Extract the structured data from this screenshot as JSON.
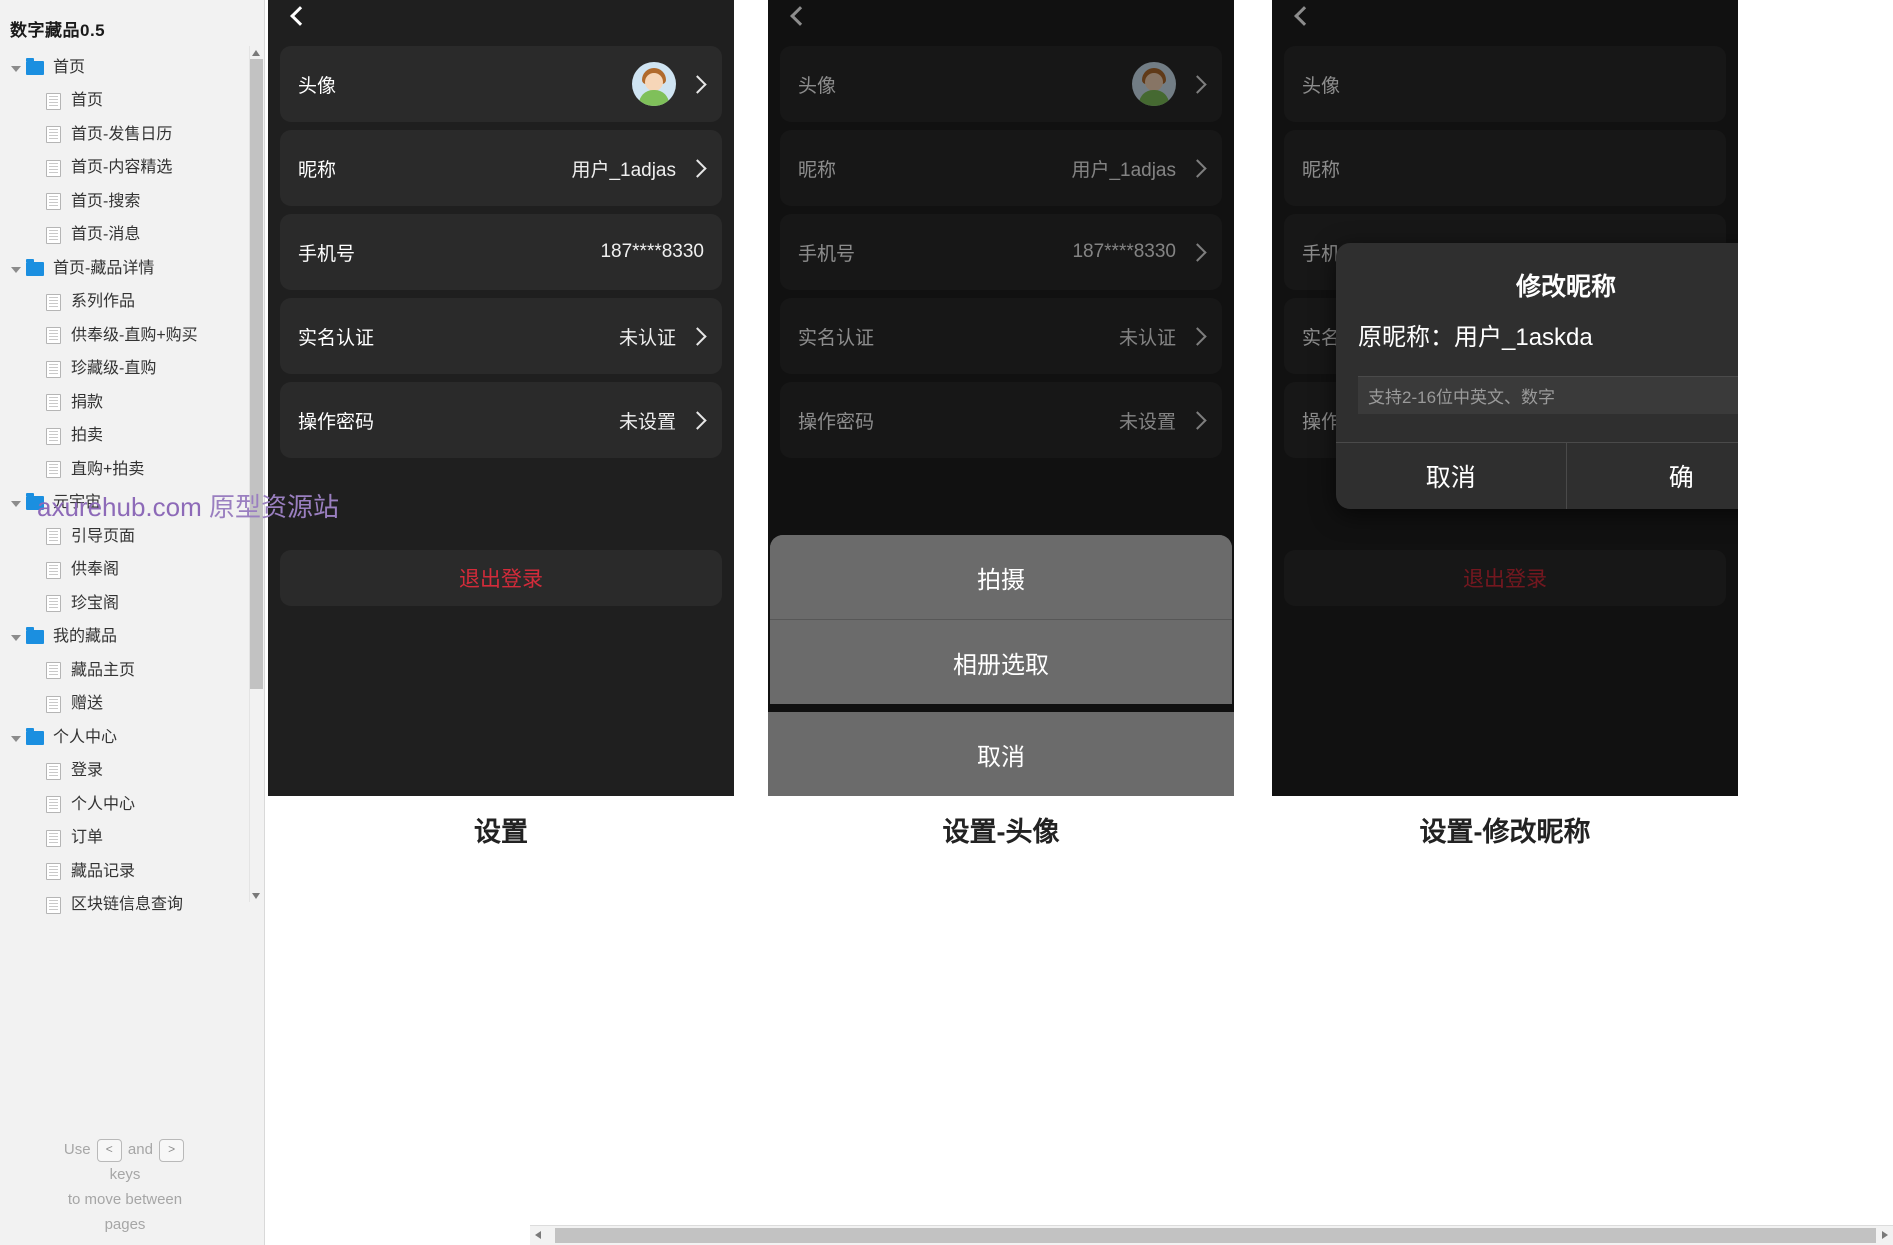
{
  "sidebar": {
    "title": "数字藏品0.5",
    "tree": [
      {
        "type": "folder",
        "label": "首页"
      },
      {
        "type": "page",
        "label": "首页"
      },
      {
        "type": "page",
        "label": "首页-发售日历"
      },
      {
        "type": "page",
        "label": "首页-内容精选"
      },
      {
        "type": "page",
        "label": "首页-搜索"
      },
      {
        "type": "page",
        "label": "首页-消息"
      },
      {
        "type": "folder",
        "label": "首页-藏品详情"
      },
      {
        "type": "page",
        "label": "系列作品"
      },
      {
        "type": "page",
        "label": "供奉级-直购+购买"
      },
      {
        "type": "page",
        "label": "珍藏级-直购"
      },
      {
        "type": "page",
        "label": "捐款"
      },
      {
        "type": "page",
        "label": "拍卖"
      },
      {
        "type": "page",
        "label": "直购+拍卖"
      },
      {
        "type": "folder",
        "label": "元宇宙"
      },
      {
        "type": "page",
        "label": "引导页面"
      },
      {
        "type": "page",
        "label": "供奉阁"
      },
      {
        "type": "page",
        "label": "珍宝阁"
      },
      {
        "type": "folder",
        "label": "我的藏品"
      },
      {
        "type": "page",
        "label": "藏品主页"
      },
      {
        "type": "page",
        "label": "赠送"
      },
      {
        "type": "folder",
        "label": "个人中心"
      },
      {
        "type": "page",
        "label": "登录"
      },
      {
        "type": "page",
        "label": "个人中心"
      },
      {
        "type": "page",
        "label": "订单"
      },
      {
        "type": "page",
        "label": "藏品记录"
      },
      {
        "type": "page",
        "label": "区块链信息查询"
      }
    ],
    "hint": {
      "use": "Use",
      "key_prev": "<",
      "and": "and",
      "key_next": ">",
      "keys": "keys",
      "line2": "to move between",
      "line3": "pages"
    }
  },
  "watermark": {
    "domain": "axurehub.com",
    "suffix": "原型资源站"
  },
  "panels": [
    {
      "caption": "设置",
      "back_icon": "chevron-left-icon",
      "rows": [
        {
          "label": "头像",
          "value": "",
          "icon": "avatar",
          "chevron": true
        },
        {
          "label": "昵称",
          "value": "用户_1adjas",
          "icon": "",
          "chevron": true
        },
        {
          "label": "手机号",
          "value": "187****8330",
          "icon": "",
          "chevron": false
        },
        {
          "label": "实名认证",
          "value": "未认证",
          "icon": "",
          "chevron": true
        },
        {
          "label": "操作密码",
          "value": "未设置",
          "icon": "",
          "chevron": true
        }
      ],
      "logout_label": "退出登录"
    },
    {
      "caption": "设置-头像",
      "back_icon": "chevron-left-icon",
      "rows": [
        {
          "label": "头像",
          "value": "",
          "icon": "avatar",
          "chevron": true
        },
        {
          "label": "昵称",
          "value": "用户_1adjas",
          "icon": "",
          "chevron": true
        },
        {
          "label": "手机号",
          "value": "187****8330",
          "icon": "",
          "chevron": true
        },
        {
          "label": "实名认证",
          "value": "未认证",
          "icon": "",
          "chevron": true
        },
        {
          "label": "操作密码",
          "value": "未设置",
          "icon": "",
          "chevron": true
        }
      ],
      "action_sheet": {
        "items": [
          "拍摄",
          "相册选取"
        ],
        "cancel": "取消"
      }
    },
    {
      "caption": "设置-修改昵称",
      "back_icon": "chevron-left-icon",
      "rows": [
        {
          "label": "头像",
          "value": "",
          "icon": "",
          "chevron": false
        },
        {
          "label": "昵称",
          "value": "",
          "icon": "",
          "chevron": false
        },
        {
          "label": "手机号",
          "value": "",
          "icon": "",
          "chevron": false
        },
        {
          "label": "实名认证",
          "value": "",
          "icon": "",
          "chevron": false
        },
        {
          "label": "操作密码",
          "value": "",
          "icon": "",
          "chevron": false
        }
      ],
      "logout_label": "退出登录",
      "modal": {
        "title": "修改昵称",
        "subtitle": "原昵称：用户_1askda",
        "input_placeholder": "支持2-16位中英文、数字",
        "cancel_label": "取消",
        "confirm_label": "确"
      }
    }
  ]
}
